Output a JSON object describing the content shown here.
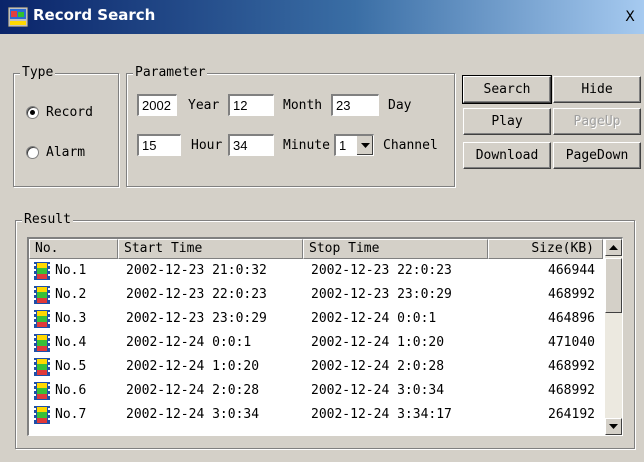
{
  "window": {
    "title": "Record Search",
    "icon": "app-icon",
    "close_label": "X"
  },
  "type_group": {
    "title": "Type",
    "options": [
      {
        "label": "Record",
        "checked": true
      },
      {
        "label": "Alarm",
        "checked": false
      }
    ]
  },
  "parameter_group": {
    "title": "Parameter",
    "year_value": "2002",
    "year_label": "Year",
    "month_value": "12",
    "month_label": "Month",
    "day_value": "23",
    "day_label": "Day",
    "hour_value": "15",
    "hour_label": "Hour",
    "minute_value": "34",
    "minute_label": "Minute",
    "channel_value": "1",
    "channel_label": "Channel"
  },
  "buttons": {
    "search": "Search",
    "hide": "Hide",
    "play": "Play",
    "pageup": "PageUp",
    "download": "Download",
    "pagedown": "PageDown"
  },
  "result": {
    "title": "Result",
    "columns": [
      "No.",
      "Start Time",
      "Stop Time",
      "Size(KB)"
    ],
    "rows": [
      {
        "no": "No.1",
        "start": "2002-12-23 21:0:32",
        "stop": "2002-12-23 22:0:23",
        "size": "466944"
      },
      {
        "no": "No.2",
        "start": "2002-12-23 22:0:23",
        "stop": "2002-12-23 23:0:29",
        "size": "468992"
      },
      {
        "no": "No.3",
        "start": "2002-12-23 23:0:29",
        "stop": "2002-12-24 0:0:1",
        "size": "464896"
      },
      {
        "no": "No.4",
        "start": "2002-12-24 0:0:1",
        "stop": "2002-12-24 1:0:20",
        "size": "471040"
      },
      {
        "no": "No.5",
        "start": "2002-12-24 1:0:20",
        "stop": "2002-12-24 2:0:28",
        "size": "468992"
      },
      {
        "no": "No.6",
        "start": "2002-12-24 2:0:28",
        "stop": "2002-12-24 3:0:34",
        "size": "468992"
      },
      {
        "no": "No.7",
        "start": "2002-12-24 3:0:34",
        "stop": "2002-12-24 3:34:17",
        "size": "264192"
      }
    ]
  },
  "colors": {
    "window_bg": "#d4d0c8",
    "title_gradient_start": "#0a246a",
    "title_gradient_end": "#a6caf0"
  }
}
